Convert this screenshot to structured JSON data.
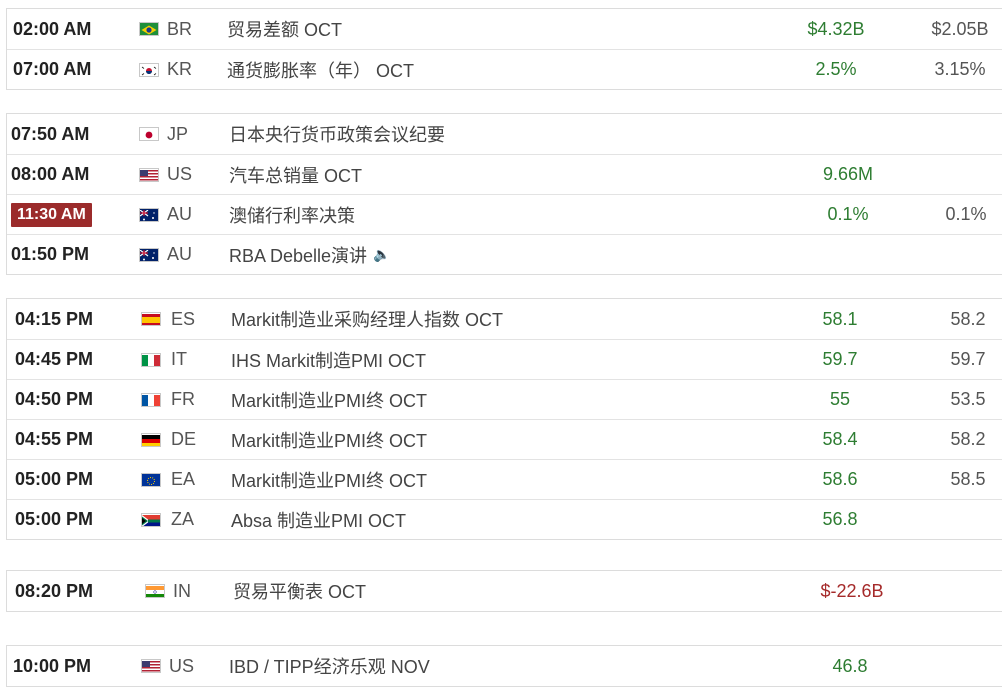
{
  "groups": [
    {
      "rows": [
        {
          "time": "02:00 AM",
          "flag": "br",
          "cc": "BR",
          "event": "贸易差额 OCT",
          "actual": "$4.32B",
          "prev": "$2.05B"
        },
        {
          "time": "07:00 AM",
          "flag": "kr",
          "cc": "KR",
          "event": "通货膨胀率（年） OCT",
          "actual": "2.5%",
          "prev": "3.15%"
        }
      ]
    },
    {
      "rows": [
        {
          "time": "07:50 AM",
          "flag": "jp",
          "cc": "JP",
          "event": "日本央行货币政策会议纪要",
          "actual": "",
          "prev": ""
        },
        {
          "time": "08:00 AM",
          "flag": "us",
          "cc": "US",
          "event": "汽车总销量 OCT",
          "actual": "9.66M",
          "prev": ""
        },
        {
          "time": "11:30 AM",
          "flag": "au",
          "cc": "AU",
          "event": "澳储行利率决策",
          "actual": "0.1%",
          "prev": "0.1%",
          "highlight": true
        },
        {
          "time": "01:50 PM",
          "flag": "au",
          "cc": "AU",
          "event": "RBA Debelle演讲",
          "actual": "",
          "prev": "",
          "speaker": true
        }
      ]
    },
    {
      "rows": [
        {
          "time": "04:15 PM",
          "flag": "es",
          "cc": "ES",
          "event": "Markit制造业采购经理人指数 OCT",
          "actual": "58.1",
          "prev": "58.2"
        },
        {
          "time": "04:45 PM",
          "flag": "it",
          "cc": "IT",
          "event": "IHS Markit制造PMI OCT",
          "actual": "59.7",
          "prev": "59.7"
        },
        {
          "time": "04:50 PM",
          "flag": "fr",
          "cc": "FR",
          "event": "Markit制造业PMI终 OCT",
          "actual": "55",
          "prev": "53.5"
        },
        {
          "time": "04:55 PM",
          "flag": "de",
          "cc": "DE",
          "event": "Markit制造业PMI终 OCT",
          "actual": "58.4",
          "prev": "58.2"
        },
        {
          "time": "05:00 PM",
          "flag": "eu",
          "cc": "EA",
          "event": "Markit制造业PMI终 OCT",
          "actual": "58.6",
          "prev": "58.5"
        },
        {
          "time": "05:00 PM",
          "flag": "za",
          "cc": "ZA",
          "event": "Absa 制造业PMI OCT",
          "actual": "56.8",
          "prev": ""
        }
      ]
    },
    {
      "rows": [
        {
          "time": "08:20 PM",
          "flag": "in",
          "cc": "IN",
          "event": "贸易平衡表 OCT",
          "actual": "$-22.6B",
          "prev": "",
          "negative": true
        }
      ]
    },
    {
      "rows": [
        {
          "time": "10:00 PM",
          "flag": "us",
          "cc": "US",
          "event": "IBD / TIPP经济乐观 NOV",
          "actual": "46.8",
          "prev": ""
        }
      ]
    }
  ],
  "colors": {
    "positive": "#2e7d32",
    "negative": "#a52a2a",
    "highlight": "#9b2b2b",
    "border": "#dcdcdc"
  },
  "icons": {
    "speaker": "speaker-icon"
  }
}
